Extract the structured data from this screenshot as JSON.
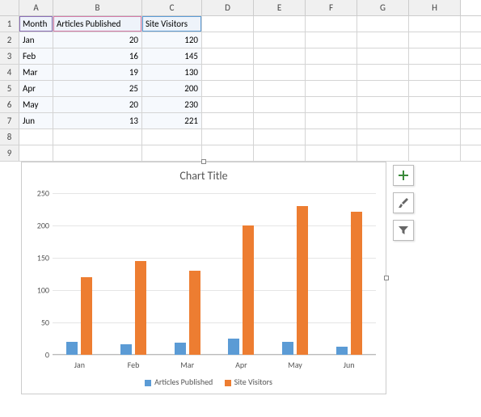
{
  "columns": [
    "A",
    "B",
    "C",
    "D",
    "E",
    "F",
    "G",
    "H"
  ],
  "table": {
    "headers": {
      "A": "Month",
      "B": "Articles Published",
      "C": "Site Visitors"
    },
    "rows": [
      {
        "A": "Jan",
        "B": "20",
        "C": "120"
      },
      {
        "A": "Feb",
        "B": "16",
        "C": "145"
      },
      {
        "A": "Mar",
        "B": "19",
        "C": "130"
      },
      {
        "A": "Apr",
        "B": "25",
        "C": "200"
      },
      {
        "A": "May",
        "B": "20",
        "C": "230"
      },
      {
        "A": "Jun",
        "B": "13",
        "C": "221"
      }
    ]
  },
  "chart_title": "Chart Title",
  "y_ticks": [
    "0",
    "50",
    "100",
    "150",
    "200",
    "250"
  ],
  "legend": {
    "s1": "Articles Published",
    "s2": "Site Visitors"
  },
  "chart_data": {
    "type": "bar",
    "title": "Chart Title",
    "xlabel": "",
    "ylabel": "",
    "ylim": [
      0,
      250
    ],
    "categories": [
      "Jan",
      "Feb",
      "Mar",
      "Apr",
      "May",
      "Jun"
    ],
    "series": [
      {
        "name": "Articles Published",
        "values": [
          20,
          16,
          19,
          25,
          20,
          13
        ],
        "color": "#5b9bd5"
      },
      {
        "name": "Site Visitors",
        "values": [
          120,
          145,
          130,
          200,
          230,
          221
        ],
        "color": "#ed7d31"
      }
    ]
  }
}
